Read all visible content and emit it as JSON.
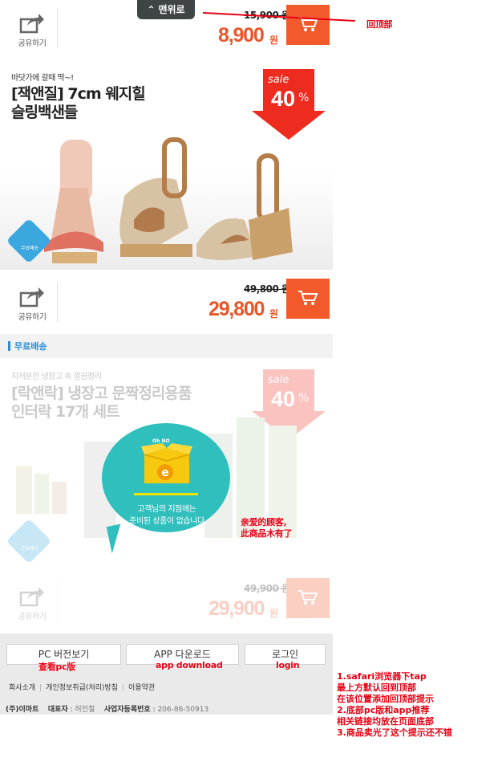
{
  "top_button": {
    "label": "맨위로"
  },
  "items": [
    {
      "share_label": "공유하기",
      "old_price": "15,900 원",
      "price": "8,900",
      "won": "원"
    },
    {
      "subtitle": "바닷가에 갈때 딱~!",
      "title_line1": "[잭앤질] 7cm 웨지힐",
      "title_line2": "슬링백샌들",
      "sale_word": "sale",
      "sale_num": "40",
      "sale_pct": "%",
      "share_label": "공유하기",
      "old_price": "49,800 원",
      "price": "29,800",
      "won": "원"
    },
    {
      "subtitle": "지저분한 냉장고 속 깔끔정리",
      "title_line1": "[락앤락] 냉장고 문짝정리용품",
      "title_line2": "인터락 17개 세트",
      "sale_word": "sale",
      "sale_num": "40",
      "sale_pct": "%",
      "share_label": "공유하기",
      "old_price": "49,900 원",
      "price": "29,900",
      "won": "원"
    }
  ],
  "free_shipping_section": "무료배송",
  "free_ship_badge": "무료배송",
  "sorry_popup": {
    "oh_no": "Oh NO",
    "line1": "고객님의 지점에는",
    "line2": "준비된 상품이 없습니다",
    "box_letter": "e"
  },
  "footer": {
    "pc_button": "PC 버전보기",
    "app_button": "APP 다운로드",
    "login_button": "로그인",
    "links": [
      "회사소개",
      "개인정보취급(처리)방침",
      "이용약관"
    ],
    "company": "(주)이마트",
    "ceo_label": "대표자",
    "ceo": "허인철",
    "reg_label": "사업자등록번호",
    "reg_no": "206-86-50913"
  },
  "annotations": {
    "back_to_top": "回顶部",
    "sorry_note_line1": "亲爱的顾客,",
    "sorry_note_line2": "此商品木有了",
    "pc_note": "查看pc版",
    "app_note": "app download",
    "login_note": "login",
    "notes": [
      "1.safari浏览器下tap",
      "最上方默认回到顶部",
      "在该位置添加回顶部提示",
      "2.底部pc版和app推荐",
      "相关链接均放在页面底部",
      "3.商品卖光了这个提示还不错"
    ]
  },
  "colors": {
    "price": "#e8572a",
    "cart": "#f25a2b",
    "sale": "#ee2b1f",
    "annotation": "#e60012",
    "accent_blue": "#2b8fd8",
    "popup": "#2fbfbd"
  }
}
